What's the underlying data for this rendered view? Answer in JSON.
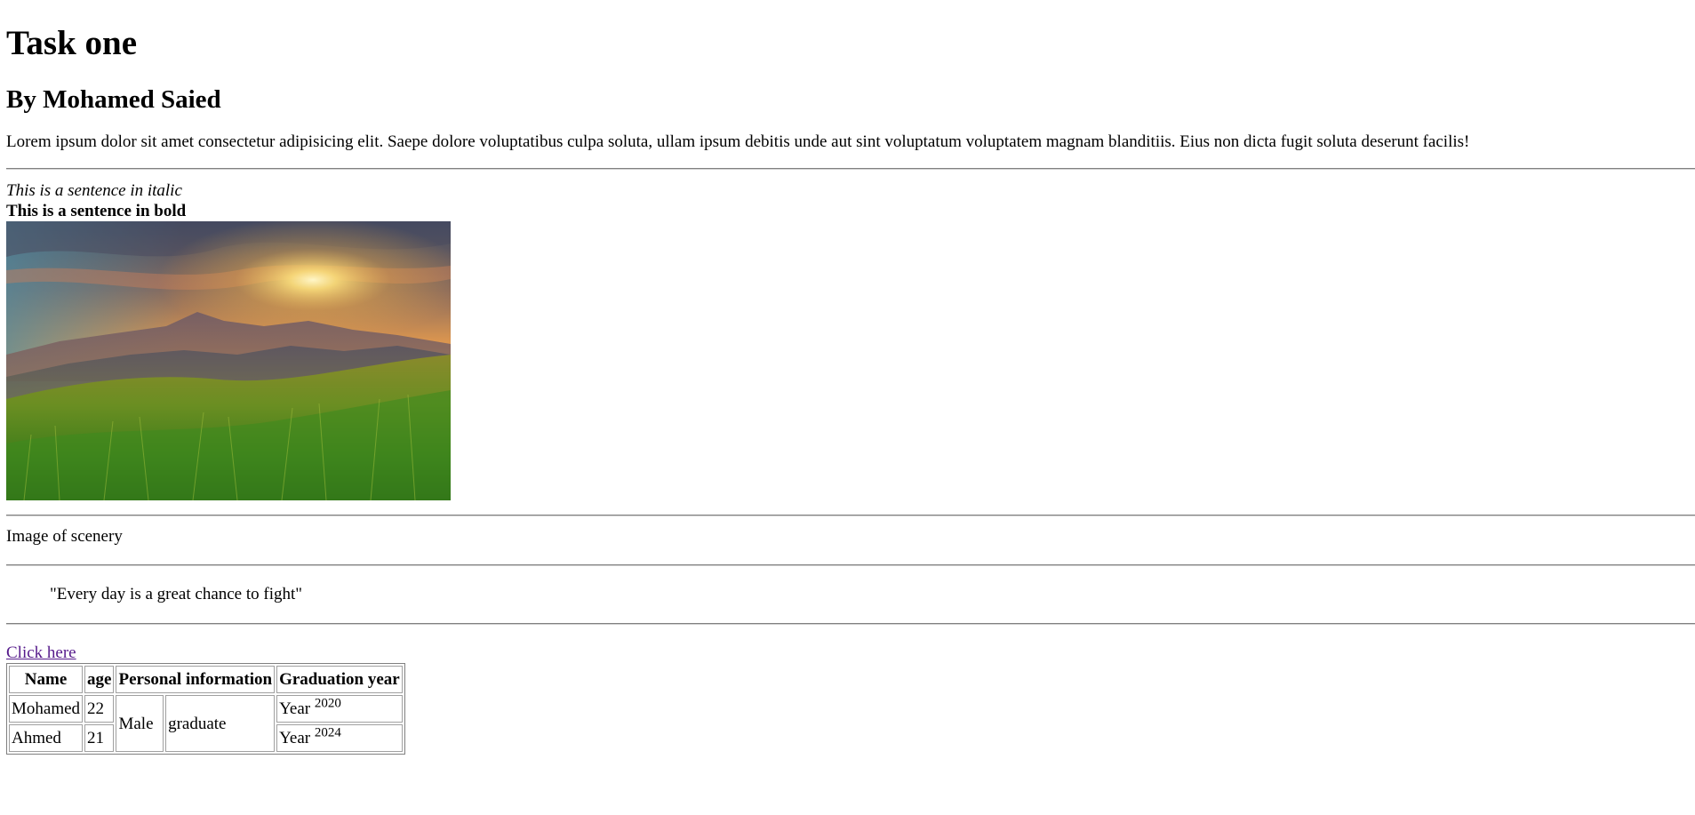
{
  "heading": "Task one",
  "byline": "By Mohamed Saied",
  "paragraph": "Lorem ipsum dolor sit amet consectetur adipisicing elit. Saepe dolore voluptatibus culpa soluta, ullam ipsum debitis unde aut sint voluptatum voluptatem magnam blanditiis. Eius non dicta fugit soluta deserunt facilis!",
  "italic_sentence": "This is a sentence in italic",
  "bold_sentence": "This is a sentence in bold",
  "image_caption": "Image of scenery",
  "quote": "\"Every day is a great chance to fight\"",
  "link_text": "Click here",
  "table": {
    "headers": {
      "name": "Name",
      "age": "age",
      "personal": "Personal information",
      "graduation": "Graduation year"
    },
    "rows": [
      {
        "name": "Mohamed",
        "age": "22",
        "year_label": "Year",
        "year_sup": "2020"
      },
      {
        "name": "Ahmed",
        "age": "21",
        "year_label": "Year",
        "year_sup": "2024"
      }
    ],
    "gender": "Male",
    "status": "graduate"
  }
}
